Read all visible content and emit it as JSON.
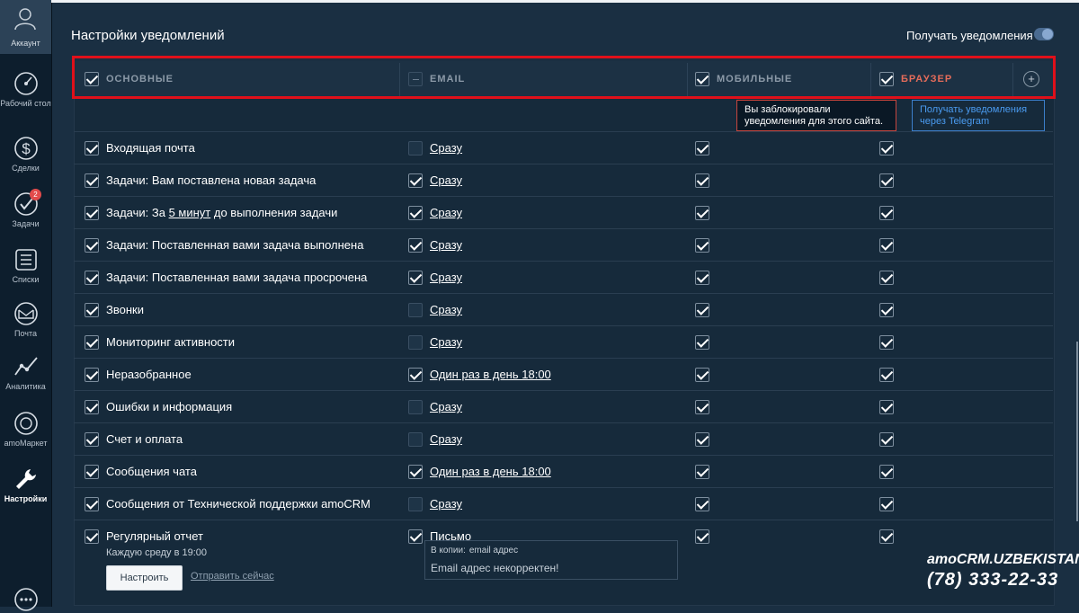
{
  "sidebar": {
    "account_label": "Аккаунт",
    "items": [
      {
        "label": "Рабочий стол",
        "icon": "speedometer-icon"
      },
      {
        "label": "Сделки",
        "icon": "dollar-icon"
      },
      {
        "label": "Задачи",
        "icon": "check-circle-icon",
        "badge": "2"
      },
      {
        "label": "Списки",
        "icon": "list-icon"
      },
      {
        "label": "Почта",
        "icon": "mail-icon"
      },
      {
        "label": "Аналитика",
        "icon": "analytics-icon"
      },
      {
        "label": "amoМаркет",
        "icon": "market-icon"
      },
      {
        "label": "Настройки",
        "icon": "wrench-icon"
      }
    ]
  },
  "header": {
    "title": "Настройки уведомлений",
    "get_notifications": "Получать уведомления"
  },
  "columns": [
    {
      "label": "ОСНОВНЫЕ",
      "checked": true
    },
    {
      "label": "EMAIL",
      "checked": false
    },
    {
      "label": "МОБИЛЬНЫЕ",
      "checked": true
    },
    {
      "label": "БРАУЗЕР",
      "checked": true
    }
  ],
  "tooltips": {
    "blocked": "Вы заблокировали уведомления для этого сайта.",
    "telegram": "Получать уведомления через Telegram"
  },
  "rows": [
    {
      "name": "Входящая почта",
      "email": false,
      "freq": "Сразу"
    },
    {
      "name": "Задачи: Вам поставлена новая задача",
      "email": true,
      "freq": "Сразу"
    },
    {
      "name_pre": "Задачи: За ",
      "name_link": "5 минут",
      "name_post": " до выполнения задачи",
      "email": true,
      "freq": "Сразу"
    },
    {
      "name": "Задачи: Поставленная вами задача выполнена",
      "email": true,
      "freq": "Сразу"
    },
    {
      "name": "Задачи: Поставленная вами задача просрочена",
      "email": true,
      "freq": "Сразу"
    },
    {
      "name": "Звонки",
      "email": false,
      "freq": "Сразу"
    },
    {
      "name": "Мониторинг активности",
      "email": false,
      "freq": "Сразу"
    },
    {
      "name": "Неразобранное",
      "email": true,
      "freq": "Один раз в день 18:00"
    },
    {
      "name": "Ошибки и информация",
      "email": false,
      "freq": "Сразу"
    },
    {
      "name": "Счет и оплата",
      "email": false,
      "freq": "Сразу"
    },
    {
      "name": "Сообщения чата",
      "email": true,
      "freq": "Один раз в день 18:00"
    },
    {
      "name": "Сообщения от Технической поддержки amoCRM",
      "email": false,
      "freq": "Сразу"
    }
  ],
  "report": {
    "name": "Регулярный отчет",
    "schedule": "Каждую среду в 19:00",
    "setup_button": "Настроить",
    "send_now": "Отправить сейчас",
    "email_type": "Письмо",
    "cc_label": "В копии:",
    "cc_placeholder": "email адрес",
    "error": "Email адрес некорректен!"
  },
  "brand": {
    "line1": "amoCRM.UZBEKISTAN",
    "phone": "(78) 333-22-33"
  }
}
